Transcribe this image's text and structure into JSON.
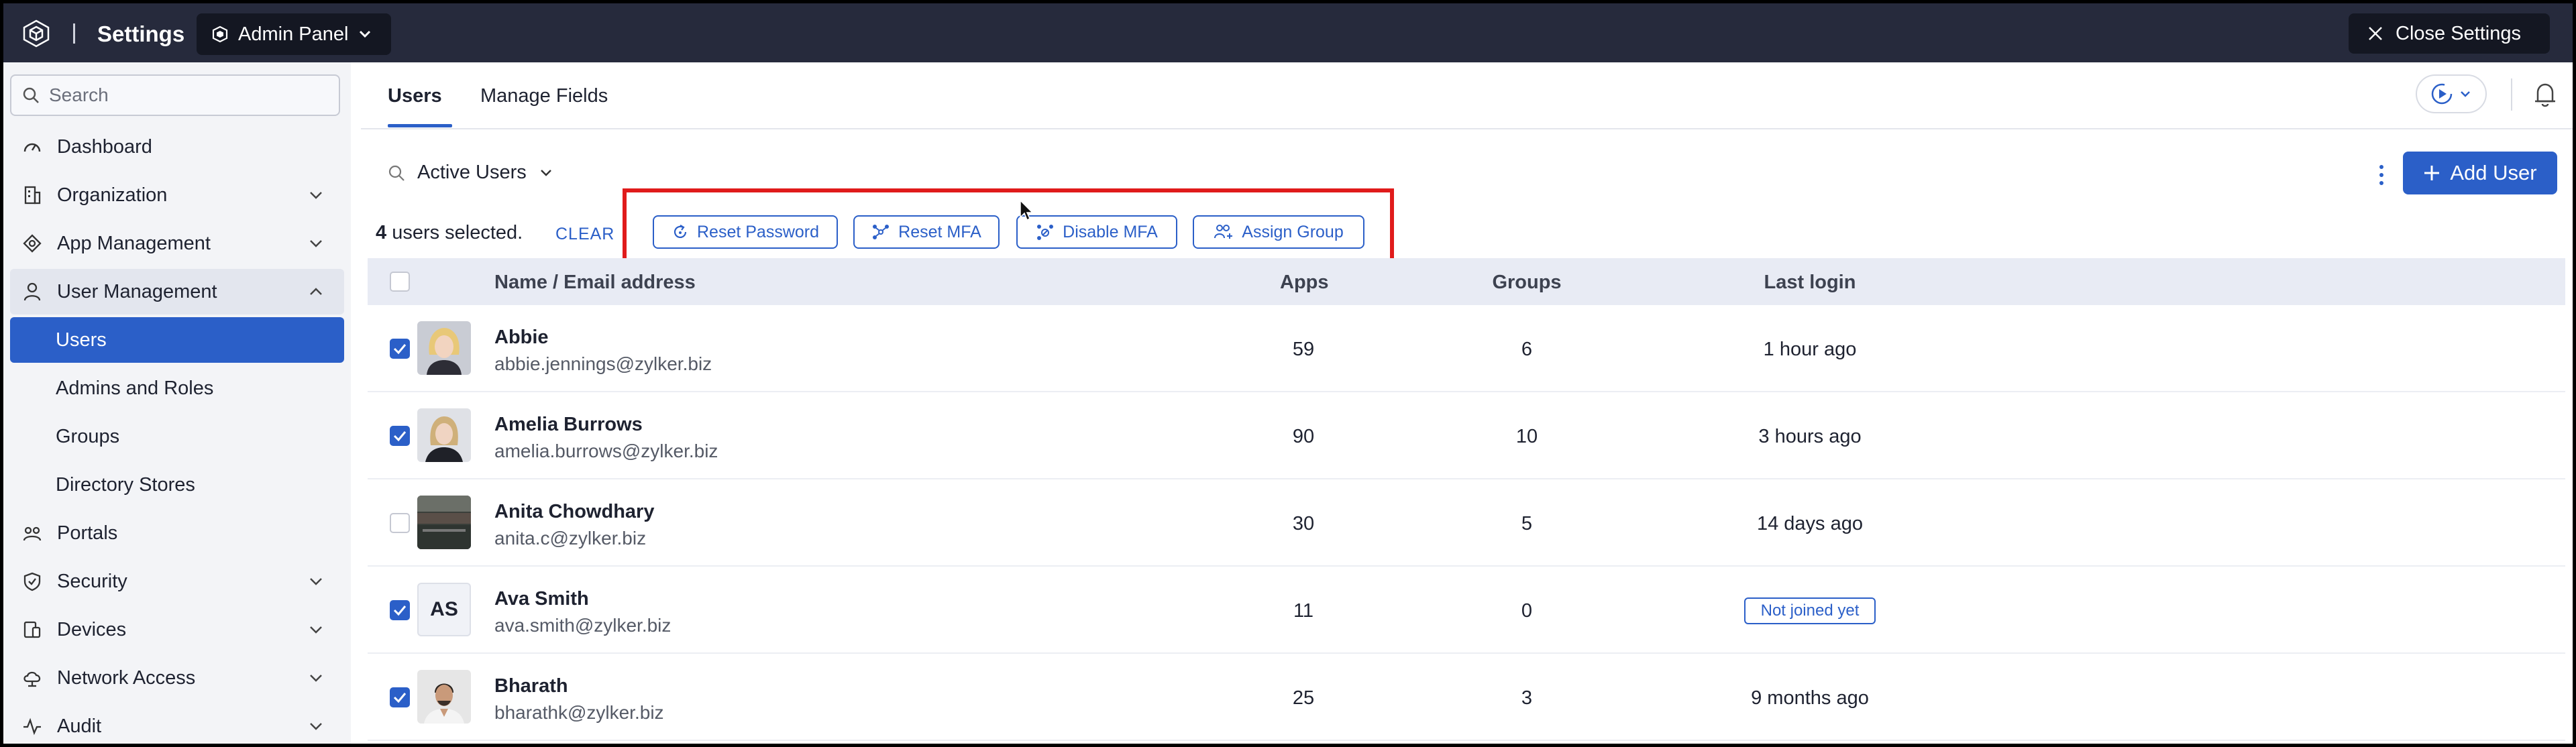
{
  "topbar": {
    "title": "Settings",
    "panel": "Admin Panel",
    "close_label": "Close Settings"
  },
  "sidebar": {
    "search_placeholder": "Search",
    "items": [
      {
        "label": "Dashboard",
        "icon": "gauge-icon"
      },
      {
        "label": "Organization",
        "icon": "building-icon"
      },
      {
        "label": "App Management",
        "icon": "apps-icon"
      },
      {
        "label": "User Management",
        "icon": "user-icon"
      },
      {
        "label": "Users"
      },
      {
        "label": "Admins and Roles"
      },
      {
        "label": "Groups"
      },
      {
        "label": "Directory Stores"
      },
      {
        "label": "Portals",
        "icon": "portal-icon"
      },
      {
        "label": "Security",
        "icon": "shield-icon"
      },
      {
        "label": "Devices",
        "icon": "devices-icon"
      },
      {
        "label": "Network Access",
        "icon": "cloud-icon"
      },
      {
        "label": "Audit",
        "icon": "activity-icon"
      }
    ]
  },
  "tabs": [
    "Users",
    "Manage Fields"
  ],
  "filter": {
    "label": "Active Users"
  },
  "add_user_label": "Add User",
  "selection": {
    "count": "4",
    "text": " users selected.",
    "clear_label": "CLEAR"
  },
  "actions": [
    "Reset Password",
    "Reset MFA",
    "Disable MFA",
    "Assign Group"
  ],
  "table": {
    "columns": [
      "Name / Email address",
      "Apps",
      "Groups",
      "Last login"
    ],
    "rows": [
      {
        "name": "Abbie",
        "email": "abbie.jennings@zylker.biz",
        "apps": "59",
        "groups": "6",
        "last_login": "1 hour ago",
        "selected": true
      },
      {
        "name": "Amelia Burrows",
        "email": "amelia.burrows@zylker.biz",
        "apps": "90",
        "groups": "10",
        "last_login": "3 hours ago",
        "selected": true
      },
      {
        "name": "Anita Chowdhary",
        "email": "anita.c@zylker.biz",
        "apps": "30",
        "groups": "5",
        "last_login": "14 days ago",
        "selected": false
      },
      {
        "name": "Ava Smith",
        "initials": "AS",
        "email": "ava.smith@zylker.biz",
        "apps": "11",
        "groups": "0",
        "last_login": "Not joined yet",
        "selected": true
      },
      {
        "name": "Bharath",
        "email": "bharathk@zylker.biz",
        "apps": "25",
        "groups": "3",
        "last_login": "9 months ago",
        "selected": true
      }
    ]
  },
  "colors": {
    "primary": "#2b5fc8",
    "topbar": "#262a3c",
    "highlight": "#e01b1b"
  }
}
